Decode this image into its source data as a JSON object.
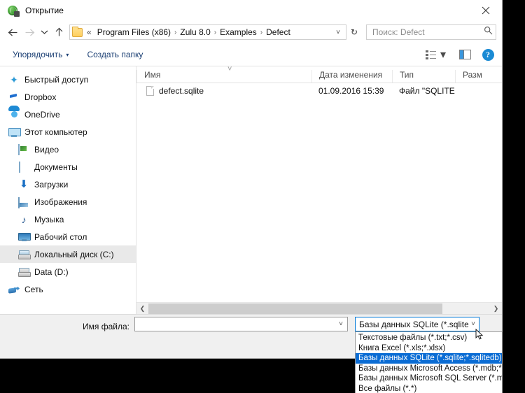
{
  "window": {
    "title": "Открытие",
    "title_icon": "globe-icon",
    "close_label": "✕"
  },
  "address": {
    "back_icon": "arrow-left-icon",
    "forward_icon": "arrow-right-icon",
    "recent_icon": "chevron-down-icon",
    "up_icon": "arrow-up-icon",
    "folder_icon": "folder-icon",
    "lead": "«",
    "crumbs": [
      "Program Files (x86)",
      "Zulu 8.0",
      "Examples",
      "Defect"
    ],
    "separator": "›",
    "path_caret": "˅",
    "refresh_icon": "refresh-icon",
    "refresh_glyph": "↻",
    "search_placeholder": "Поиск: Defect",
    "search_icon": "search-icon"
  },
  "toolbar": {
    "organize_label": "Упорядочить",
    "organize_caret": "▾",
    "new_folder_label": "Создать папку",
    "view_icon": "view-options-icon",
    "view_caret": "▾",
    "preview_pane_icon": "preview-pane-icon",
    "help_icon": "help-icon",
    "help_glyph": "?"
  },
  "sidebar": {
    "items": [
      {
        "label": "Быстрый доступ",
        "icon": "star-icon",
        "indent": false,
        "selected": false
      },
      {
        "label": "Dropbox",
        "icon": "dropbox-icon",
        "indent": false,
        "selected": false
      },
      {
        "label": "OneDrive",
        "icon": "cloud-icon",
        "indent": false,
        "selected": false
      },
      {
        "label": "Этот компьютер",
        "icon": "computer-icon",
        "indent": false,
        "selected": false
      },
      {
        "label": "Видео",
        "icon": "video-icon",
        "indent": true,
        "selected": false
      },
      {
        "label": "Документы",
        "icon": "documents-icon",
        "indent": true,
        "selected": false
      },
      {
        "label": "Загрузки",
        "icon": "downloads-icon",
        "indent": true,
        "selected": false
      },
      {
        "label": "Изображения",
        "icon": "pictures-icon",
        "indent": true,
        "selected": false
      },
      {
        "label": "Музыка",
        "icon": "music-icon",
        "indent": true,
        "selected": false
      },
      {
        "label": "Рабочий стол",
        "icon": "desktop-icon",
        "indent": true,
        "selected": false
      },
      {
        "label": "Локальный диск (C:)",
        "icon": "disk-icon",
        "indent": true,
        "selected": true
      },
      {
        "label": "Data (D:)",
        "icon": "disk-icon",
        "indent": true,
        "selected": false
      },
      {
        "label": "Сеть",
        "icon": "network-icon",
        "indent": false,
        "selected": false
      }
    ]
  },
  "filelist": {
    "columns": [
      "Имя",
      "Дата изменения",
      "Тип",
      "Разм"
    ],
    "sort_caret": "˅",
    "rows": [
      {
        "name": "defect.sqlite",
        "date": "01.09.2016 15:39",
        "type": "Файл \"SQLITE\"",
        "size": ""
      }
    ],
    "scroll_left_icon": "chevron-left-icon",
    "scroll_right_icon": "chevron-right-icon",
    "scroll_left_glyph": "❮",
    "scroll_right_glyph": "❯"
  },
  "footer": {
    "filename_label": "Имя файла:",
    "filename_value": "",
    "filename_caret": "˅",
    "filetype_value": "Базы данных SQLite (*.sqlite;*.s",
    "filetype_caret": "˅",
    "filetype_options": [
      {
        "label": "Текстовые файлы (*.txt;*.csv)",
        "selected": false
      },
      {
        "label": "Книга Excel (*.xls;*.xlsx)",
        "selected": false
      },
      {
        "label": "Базы данных SQLite (*.sqlite;*.sqlitedb)",
        "selected": true
      },
      {
        "label": "Базы данных Microsoft Access (*.mdb;*.accdb)",
        "selected": false
      },
      {
        "label": "Базы данных Microsoft SQL Server (*.mdf)",
        "selected": false
      },
      {
        "label": "Все файлы (*.*)",
        "selected": false
      }
    ]
  },
  "colors": {
    "accent": "#0a6cd4",
    "focus_border": "#0078d7",
    "link": "#1b3f73",
    "selection_bg": "#e9e9e9"
  }
}
